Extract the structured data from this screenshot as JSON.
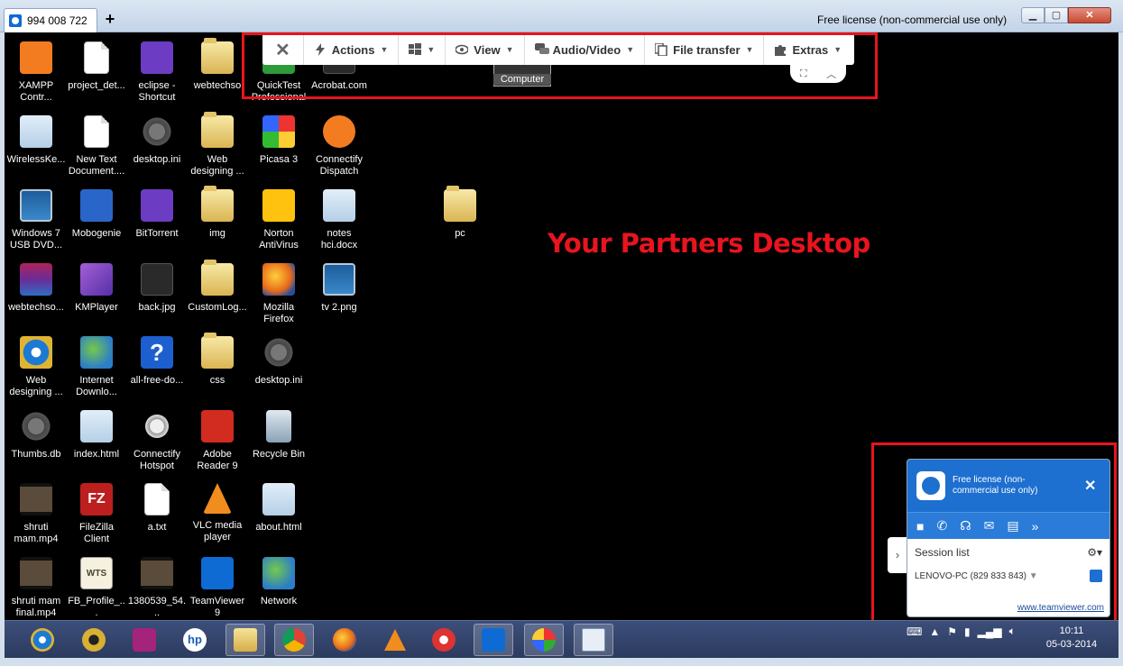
{
  "window": {
    "tab_label": "994 008 722",
    "new_tab_symbol": "+",
    "license_text": "Free license (non-commercial use only)"
  },
  "toolbar": {
    "close_symbol": "✕",
    "actions": "Actions",
    "view": "View",
    "audio_video": "Audio/Video",
    "file_transfer": "File transfer",
    "extras": "Extras"
  },
  "desktop_icons": [
    {
      "label": "XAMPP Contr...",
      "icon": "xampp-icon"
    },
    {
      "label": "project_det...",
      "icon": "document-icon"
    },
    {
      "label": "eclipse - Shortcut",
      "icon": "eclipse-icon"
    },
    {
      "label": "webtechso",
      "icon": "folder-icon"
    },
    {
      "label": "QuickTest Professional",
      "icon": "quicktest-icon"
    },
    {
      "label": "Acrobat.com",
      "icon": "acrobat-com-icon"
    },
    {
      "label": "WirelessKe...",
      "icon": "notepad-icon"
    },
    {
      "label": "New Text Document....",
      "icon": "document-icon"
    },
    {
      "label": "desktop.ini",
      "icon": "gear-file-icon"
    },
    {
      "label": "Web designing ...",
      "icon": "folder-icon"
    },
    {
      "label": "Picasa 3",
      "icon": "picasa-icon"
    },
    {
      "label": "Connectify Dispatch",
      "icon": "connectify-icon"
    },
    {
      "label": "Windows 7 USB DVD...",
      "icon": "usb-tool-icon"
    },
    {
      "label": "Mobogenie",
      "icon": "mobogenie-icon"
    },
    {
      "label": "BitTorrent",
      "icon": "bittorrent-icon"
    },
    {
      "label": "img",
      "icon": "folder-icon"
    },
    {
      "label": "Norton AntiVirus",
      "icon": "norton-icon"
    },
    {
      "label": "notes hci.docx",
      "icon": "word-doc-icon"
    },
    {
      "label": "pc",
      "icon": "folder-icon"
    },
    {
      "label": "webtechso...",
      "icon": "winrar-icon"
    },
    {
      "label": "KMPlayer",
      "icon": "kmplayer-icon"
    },
    {
      "label": "back.jpg",
      "icon": "image-file-icon"
    },
    {
      "label": "CustomLog...",
      "icon": "folder-icon"
    },
    {
      "label": "Mozilla Firefox",
      "icon": "firefox-icon"
    },
    {
      "label": "tv 2.png",
      "icon": "image-file-icon"
    },
    {
      "label": "Web designing ...",
      "icon": "ie-icon"
    },
    {
      "label": "Internet Downlo...",
      "icon": "idm-icon"
    },
    {
      "label": "all-free-do...",
      "icon": "help-icon"
    },
    {
      "label": "css",
      "icon": "folder-icon"
    },
    {
      "label": "desktop.ini",
      "icon": "gear-file-icon"
    },
    {
      "label": "Thumbs.db",
      "icon": "gear-file-icon"
    },
    {
      "label": "index.html",
      "icon": "notepad-icon"
    },
    {
      "label": "Connectify Hotspot",
      "icon": "hotspot-icon"
    },
    {
      "label": "Adobe Reader 9",
      "icon": "adobe-reader-icon"
    },
    {
      "label": "Recycle Bin",
      "icon": "recycle-bin-icon"
    },
    {
      "label": "shruti mam.mp4",
      "icon": "video-file-icon"
    },
    {
      "label": "FileZilla Client",
      "icon": "filezilla-icon"
    },
    {
      "label": "a.txt",
      "icon": "document-icon"
    },
    {
      "label": "VLC media player",
      "icon": "vlc-icon"
    },
    {
      "label": "about.html",
      "icon": "notepad-icon"
    },
    {
      "label": "shruti mam final.mp4",
      "icon": "video-file-icon"
    },
    {
      "label": "FB_Profile_...",
      "icon": "wts-file-icon"
    },
    {
      "label": "1380539_54...",
      "icon": "image-file-icon"
    },
    {
      "label": "TeamViewer 9",
      "icon": "teamviewer-icon"
    },
    {
      "label": "Network",
      "icon": "network-icon"
    }
  ],
  "computer_label": "Computer",
  "overlay_caption": "Your Partners Desktop",
  "tv_panel": {
    "license_text": "Free license (non-commercial use only)",
    "close_symbol": "✕",
    "session_list": "Session list",
    "session_entry": "LENOVO-PC (829 833 843)",
    "link": "www.teamviewer.com",
    "expand_symbol": "›",
    "more_symbol": "»"
  },
  "taskbar": {
    "apps": [
      "internet-explorer-icon",
      "media-player-icon",
      "connectify-icon",
      "hp-icon",
      "explorer-icon",
      "chrome-icon",
      "firefox-icon",
      "vlc-icon",
      "ccleaner-icon",
      "teamviewer-icon",
      "paint-icon",
      "wordpad-icon"
    ],
    "clock_time": "10:11",
    "clock_date": "05-03-2014"
  },
  "colors": {
    "annotation": "#e8141e",
    "tv_blue": "#1d6fd0"
  }
}
